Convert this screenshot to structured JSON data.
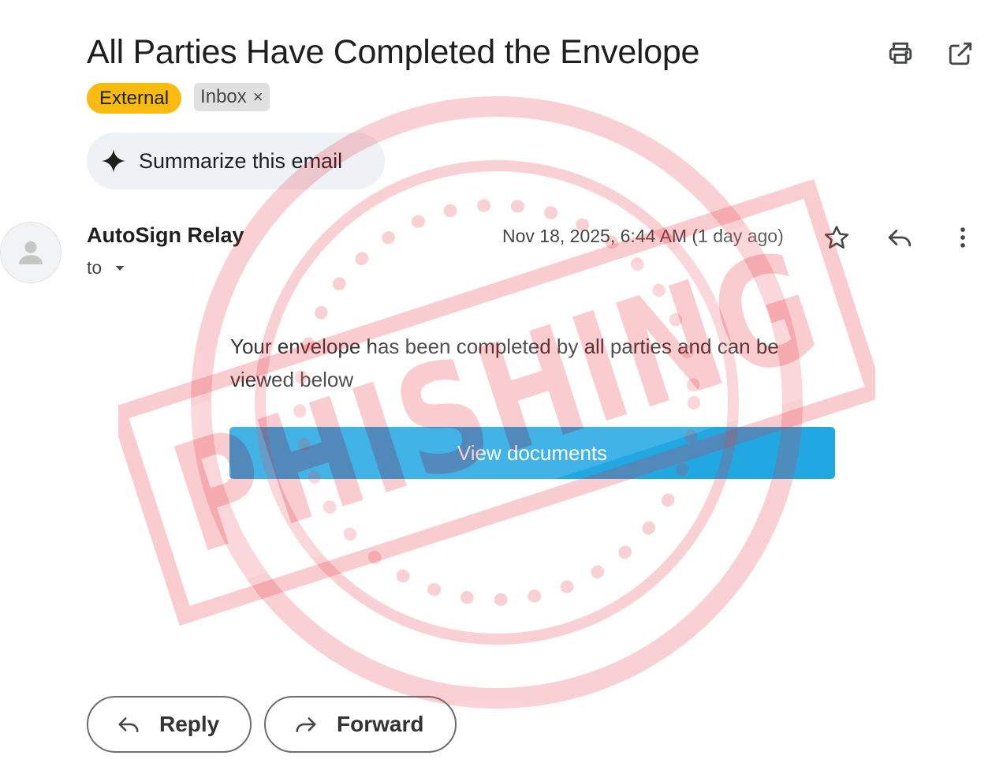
{
  "subject": "All Parties Have Completed the Envelope",
  "labels": {
    "external": "External",
    "inbox": "Inbox",
    "inbox_remove": "×"
  },
  "summarize": {
    "label": "Summarize this email"
  },
  "sender": {
    "name": "AutoSign Relay",
    "to_label": "to"
  },
  "message": {
    "date": "Nov 18, 2025, 6:44 AM (1 day ago)",
    "body": "Your envelope has been completed by all parties and can be viewed below",
    "cta": "View documents"
  },
  "actions": {
    "reply": "Reply",
    "forward": "Forward"
  },
  "stamp": {
    "text": "PHISHING",
    "color": "#e8333f"
  },
  "colors": {
    "external_label": "#f9bb10",
    "cta_button": "#21a7e2"
  },
  "icons": [
    "printer-icon",
    "open-in-new-icon",
    "sparkle-icon",
    "person-icon",
    "caret-down-icon",
    "star-icon",
    "reply-icon",
    "more-vert-icon",
    "forward-icon"
  ]
}
